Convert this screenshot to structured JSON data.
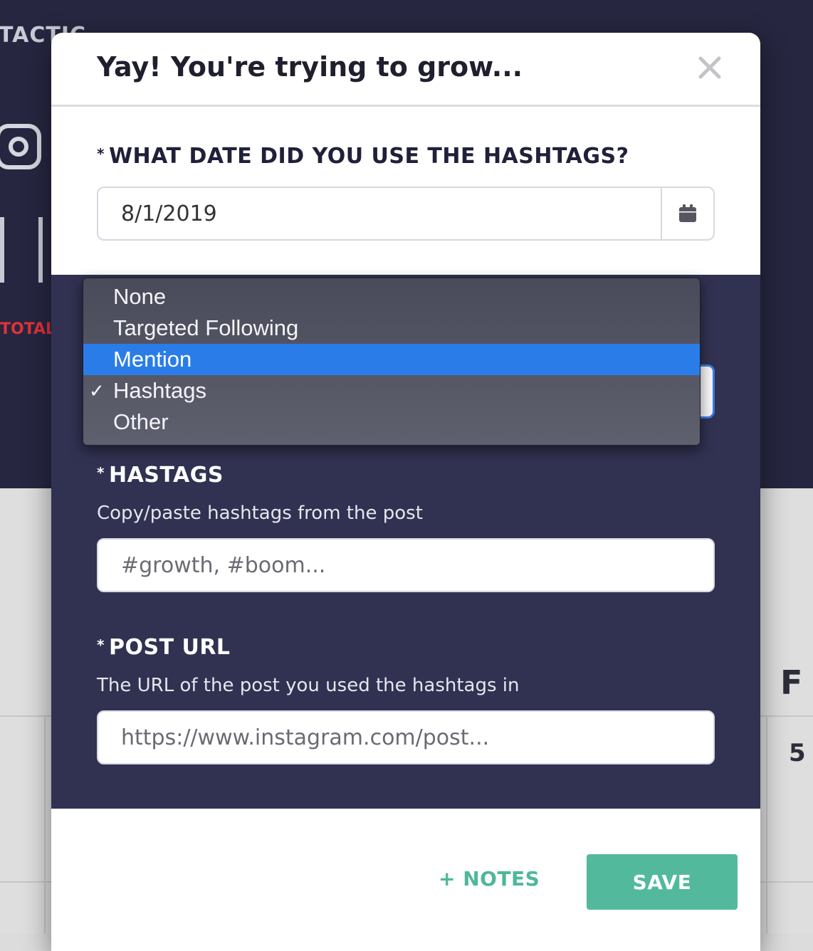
{
  "background": {
    "tactic_heading": "TACTIC",
    "total_label": "TOTAL",
    "calendar_day_header": "F",
    "calendar_date": "5"
  },
  "modal": {
    "title": "Yay! You're trying to grow...",
    "close_glyph": "×",
    "date_field": {
      "required_mark": "*",
      "label": "WHAT DATE DID YOU USE THE HASHTAGS?",
      "value": "8/1/2019",
      "button_icon": "calendar-icon"
    },
    "tactic_dropdown": {
      "options": [
        "None",
        "Targeted Following",
        "Mention",
        "Hashtags",
        "Other"
      ],
      "highlighted": "Mention",
      "selected": "Hashtags",
      "check_glyph": "✓"
    },
    "hashtags_field": {
      "required_mark": "*",
      "label": "HASTAGS",
      "help": "Copy/paste hashtags from the post",
      "placeholder": "#growth, #boom..."
    },
    "post_url_field": {
      "required_mark": "*",
      "label": "POST URL",
      "help": "The URL of the post you used the hashtags in",
      "placeholder": "https://www.instagram.com/post..."
    },
    "footer": {
      "notes_label": "+ NOTES",
      "save_label": "SAVE"
    }
  },
  "colors": {
    "accent_green": "#53b99d",
    "dropdown_highlight": "#2a7de8",
    "modal_dark_section": "#313152"
  }
}
